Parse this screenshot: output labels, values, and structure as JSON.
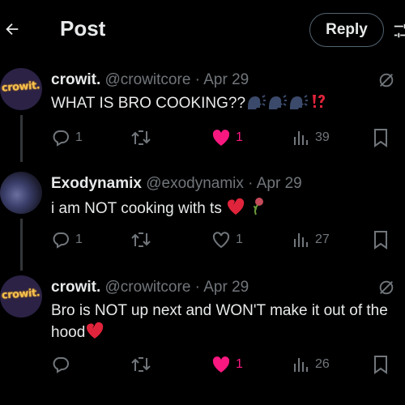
{
  "header": {
    "title": "Post",
    "reply_button": "Reply",
    "back_icon": "arrow-left-icon",
    "filter_icon": "filter-icon"
  },
  "posts": [
    {
      "avatar_text": "crowit.",
      "name": "crowit.",
      "handle": "@crowitcore",
      "date": "Apr 29",
      "sep": " · ",
      "text": "WHAT IS BRO COOKING??",
      "emojis": [
        "speaking-head-emoji",
        "speaking-head-emoji",
        "speaking-head-emoji",
        "exclamation-question-emoji"
      ],
      "replies": "1",
      "retweets": "",
      "likes": "1",
      "liked": true,
      "views": "39"
    },
    {
      "avatar_text": "",
      "name": "Exodynamix",
      "handle": "@exodynamix",
      "date": "Apr 29",
      "sep": " · ",
      "text": "i am NOT cooking with ts",
      "emojis": [
        "broken-heart-emoji",
        "wilted-rose-emoji"
      ],
      "replies": "1",
      "retweets": "",
      "likes": "1",
      "liked": false,
      "views": "27"
    },
    {
      "avatar_text": "crowit.",
      "name": "crowit.",
      "handle": "@crowitcore",
      "date": "Apr 29",
      "sep": " · ",
      "text": "Bro is NOT up next and WON'T make it out of the hood",
      "emojis": [
        "broken-heart-emoji"
      ],
      "replies": "",
      "retweets": "",
      "likes": "1",
      "liked": true,
      "views": "26"
    }
  ],
  "colors": {
    "background": "#000000",
    "text": "#e7e9ea",
    "muted": "#71767b",
    "like": "#f91880",
    "avatar_text": "#f2c14e"
  }
}
